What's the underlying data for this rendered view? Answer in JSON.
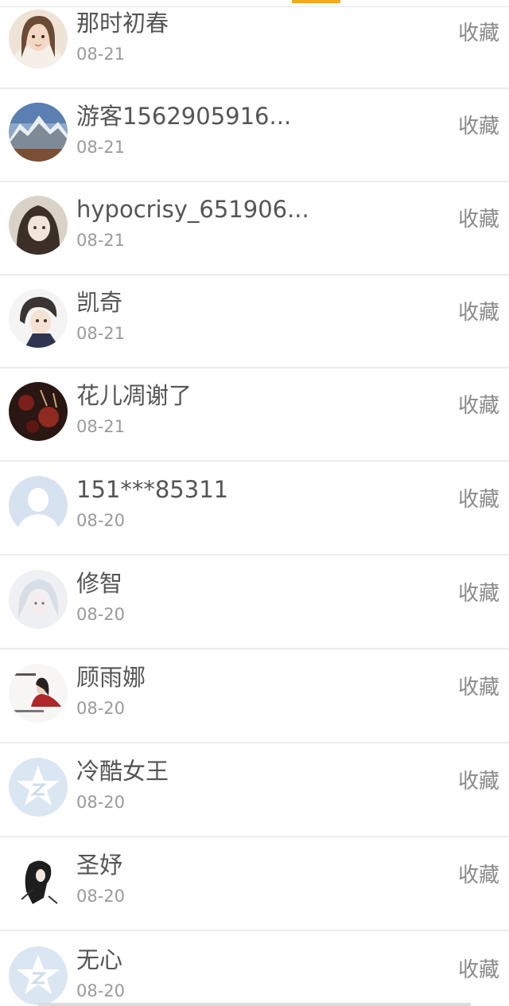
{
  "colors": {
    "accent": "#f5a623",
    "name_text": "#555555",
    "date_text": "#9a9a9a",
    "action_text": "#8a8a8a",
    "divider": "#ececec"
  },
  "list": {
    "items": [
      {
        "name": "那时初春",
        "date": "08-21",
        "action": "收藏",
        "avatar": "photo-girl-light"
      },
      {
        "name": "游客1562905916...",
        "date": "08-21",
        "action": "收藏",
        "avatar": "photo-mountains"
      },
      {
        "name": "hypocrisy_651906...",
        "date": "08-21",
        "action": "收藏",
        "avatar": "photo-anime-girl"
      },
      {
        "name": "凯奇",
        "date": "08-21",
        "action": "收藏",
        "avatar": "photo-anime-boy"
      },
      {
        "name": "花儿凋谢了",
        "date": "08-21",
        "action": "收藏",
        "avatar": "photo-dark-red"
      },
      {
        "name": "151***85311",
        "date": "08-20",
        "action": "收藏",
        "avatar": "default-person"
      },
      {
        "name": "修智",
        "date": "08-20",
        "action": "收藏",
        "avatar": "photo-white-hair"
      },
      {
        "name": "顾雨娜",
        "date": "08-20",
        "action": "收藏",
        "avatar": "photo-text-figure"
      },
      {
        "name": "冷酷女王",
        "date": "08-20",
        "action": "收藏",
        "avatar": "qq-star"
      },
      {
        "name": "圣妤",
        "date": "08-20",
        "action": "收藏",
        "avatar": "photo-ink-figure"
      },
      {
        "name": "无心",
        "date": "08-20",
        "action": "收藏",
        "avatar": "qq-star"
      }
    ]
  }
}
